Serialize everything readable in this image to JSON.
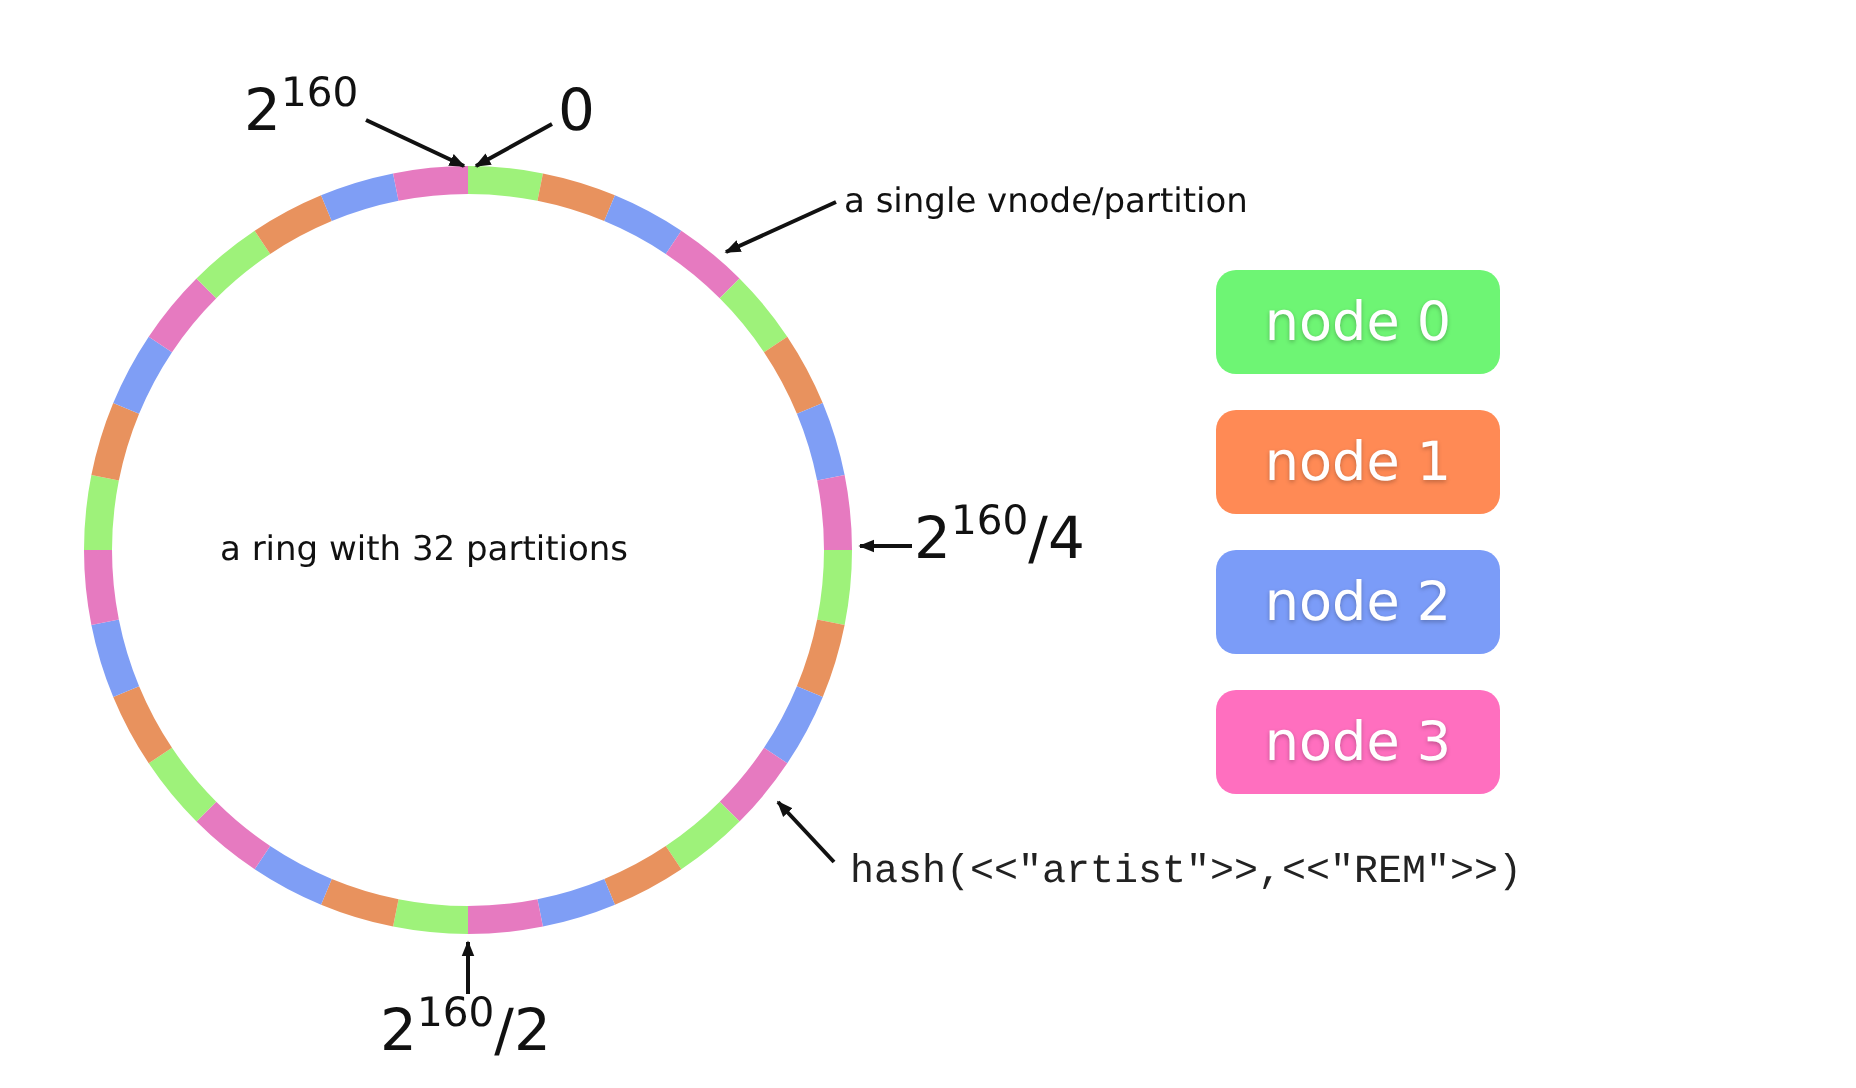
{
  "ring": {
    "caption": "a ring with 32 partitions",
    "partitions": [
      {
        "color": "#9ef27a"
      },
      {
        "color": "#e8925e"
      },
      {
        "color": "#7f9ef5"
      },
      {
        "color": "#e67ac0"
      },
      {
        "color": "#9ef27a"
      },
      {
        "color": "#e8925e"
      },
      {
        "color": "#7f9ef5"
      },
      {
        "color": "#e67ac0"
      },
      {
        "color": "#9ef27a"
      },
      {
        "color": "#e8925e"
      },
      {
        "color": "#7f9ef5"
      },
      {
        "color": "#e67ac0"
      },
      {
        "color": "#9ef27a"
      },
      {
        "color": "#e8925e"
      },
      {
        "color": "#7f9ef5"
      },
      {
        "color": "#e67ac0"
      },
      {
        "color": "#9ef27a"
      },
      {
        "color": "#e8925e"
      },
      {
        "color": "#7f9ef5"
      },
      {
        "color": "#e67ac0"
      },
      {
        "color": "#9ef27a"
      },
      {
        "color": "#e8925e"
      },
      {
        "color": "#7f9ef5"
      },
      {
        "color": "#e67ac0"
      },
      {
        "color": "#9ef27a"
      },
      {
        "color": "#e8925e"
      },
      {
        "color": "#7f9ef5"
      },
      {
        "color": "#e67ac0"
      },
      {
        "color": "#9ef27a"
      },
      {
        "color": "#e8925e"
      },
      {
        "color": "#7f9ef5"
      },
      {
        "color": "#e67ac0"
      }
    ]
  },
  "annotations": [
    {
      "kind": "ring-max",
      "text": "2$^{160}$"
    },
    {
      "kind": "ring-zero",
      "text": "0"
    },
    {
      "kind": "partition",
      "text": "a single vnode/partition"
    },
    {
      "kind": "quarter",
      "text": "2$^{160}$/4"
    },
    {
      "kind": "hash",
      "text": "hash(<<\"artist\">>,<<\"REM\">>)"
    },
    {
      "kind": "half",
      "text": "2$^{160}$/2"
    }
  ],
  "legend": [
    {
      "label": "node 0",
      "color": "#6ef574"
    },
    {
      "label": "node 1",
      "color": "#ff8a55"
    },
    {
      "label": "node 2",
      "color": "#7b9cf8"
    },
    {
      "label": "node 3",
      "color": "#ff6fbf"
    }
  ]
}
